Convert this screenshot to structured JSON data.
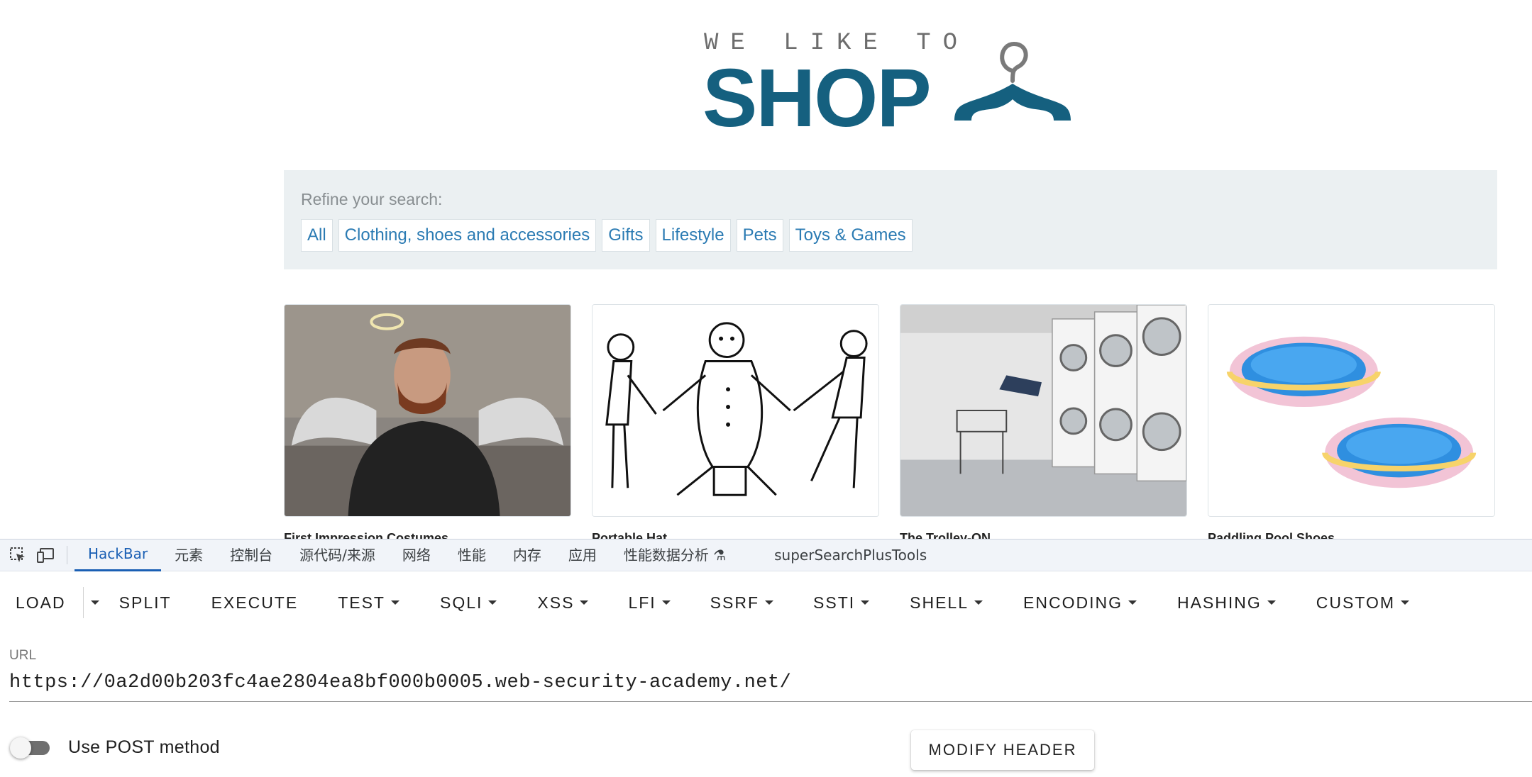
{
  "logo": {
    "top_text": "WE LIKE TO",
    "main_text": "SHOP",
    "color": "#15607f"
  },
  "filters": {
    "heading": "Refine your search:",
    "items": [
      {
        "label": "All"
      },
      {
        "label": "Clothing, shoes and accessories"
      },
      {
        "label": "Gifts"
      },
      {
        "label": "Lifestyle"
      },
      {
        "label": "Pets"
      },
      {
        "label": "Toys & Games"
      }
    ]
  },
  "products": [
    {
      "name": "First Impression Costumes",
      "image": "angel-man-image"
    },
    {
      "name": "Portable Hat",
      "image": "sketch-people-image"
    },
    {
      "name": "The Trolley-ON",
      "image": "laundromat-image"
    },
    {
      "name": "Paddling Pool Shoes",
      "image": "paddling-pools-image"
    }
  ],
  "devtools": {
    "tabs": [
      {
        "label": "HackBar",
        "active": true
      },
      {
        "label": "元素"
      },
      {
        "label": "控制台"
      },
      {
        "label": "源代码/来源"
      },
      {
        "label": "网络"
      },
      {
        "label": "性能"
      },
      {
        "label": "内存"
      },
      {
        "label": "应用"
      },
      {
        "label": "性能数据分析 ⚗"
      },
      {
        "label": "superSearchPlusTools"
      }
    ],
    "accent": "#1a5fb4"
  },
  "hackbar": {
    "buttons": {
      "load": "LOAD",
      "split": "SPLIT",
      "execute": "EXECUTE",
      "test": "TEST",
      "sqli": "SQLI",
      "xss": "XSS",
      "lfi": "LFI",
      "ssrf": "SSRF",
      "ssti": "SSTI",
      "shell": "SHELL",
      "encoding": "ENCODING",
      "hashing": "HASHING",
      "custom": "CUSTOM"
    },
    "url_label": "URL",
    "url_value": "https://0a2d00b203fc4ae2804ea8bf000b0005.web-security-academy.net/",
    "post_label": "Use POST method",
    "post_enabled": false,
    "modify_header": "MODIFY HEADER"
  }
}
